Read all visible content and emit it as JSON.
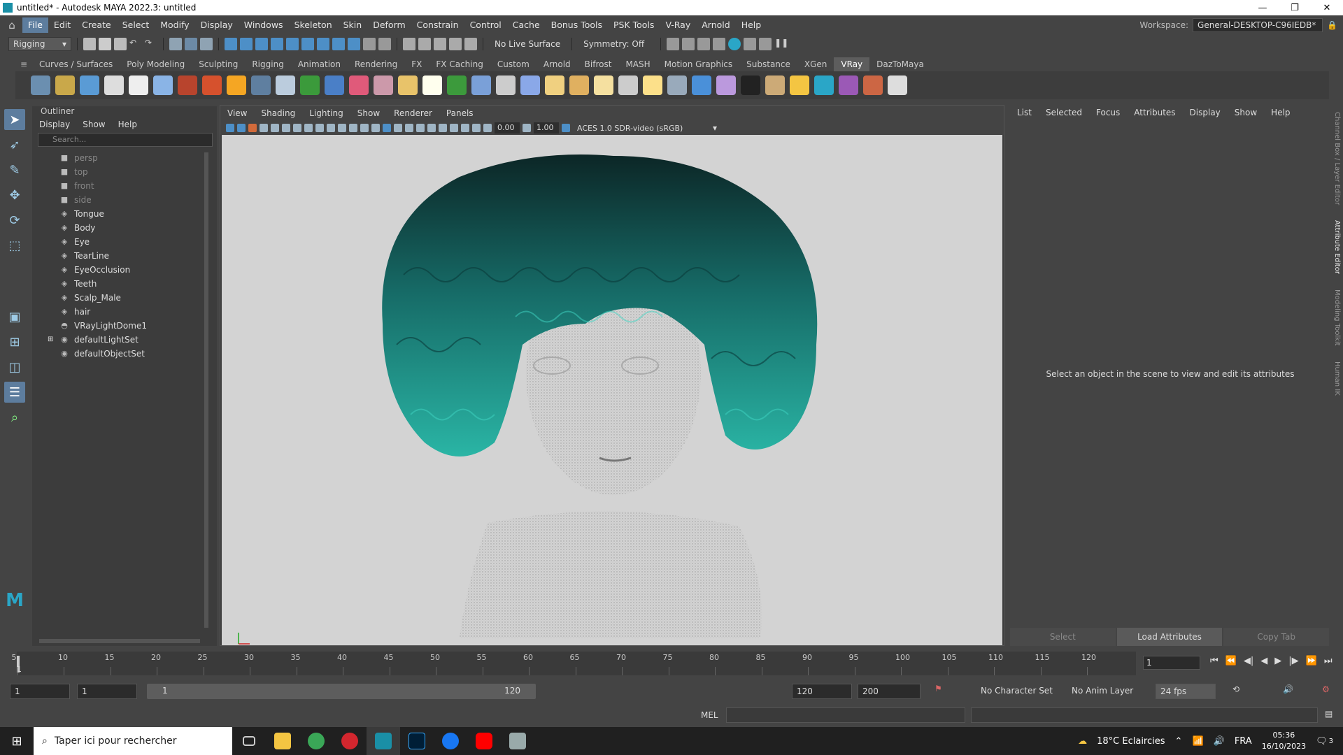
{
  "window": {
    "title": "untitled* - Autodesk MAYA 2022.3: untitled",
    "min": "—",
    "restore": "❐",
    "close": "✕"
  },
  "menu": {
    "items": [
      "File",
      "Edit",
      "Create",
      "Select",
      "Modify",
      "Display",
      "Windows",
      "Skeleton",
      "Skin",
      "Deform",
      "Constrain",
      "Control",
      "Cache",
      "Bonus Tools",
      "PSK Tools",
      "V-Ray",
      "Arnold",
      "Help"
    ],
    "workspace_label": "Workspace:",
    "workspace_value": "General-DESKTOP-C96IEDB*"
  },
  "status": {
    "menuset": "Rigging",
    "live_surface": "No Live Surface",
    "symmetry": "Symmetry: Off"
  },
  "shelf_tabs": [
    "Curves / Surfaces",
    "Poly Modeling",
    "Sculpting",
    "Rigging",
    "Animation",
    "Rendering",
    "FX",
    "FX Caching",
    "Custom",
    "Arnold",
    "Bifrost",
    "MASH",
    "Motion Graphics",
    "Substance",
    "XGen",
    "VRay",
    "DazToMaya"
  ],
  "shelf_active": "VRay",
  "outliner": {
    "title": "Outliner",
    "menu": [
      "Display",
      "Show",
      "Help"
    ],
    "search_placeholder": "Search...",
    "items": [
      {
        "label": "persp",
        "icon": "camera-icon",
        "dim": true
      },
      {
        "label": "top",
        "icon": "camera-icon",
        "dim": true
      },
      {
        "label": "front",
        "icon": "camera-icon",
        "dim": true
      },
      {
        "label": "side",
        "icon": "camera-icon",
        "dim": true
      },
      {
        "label": "Tongue",
        "icon": "mesh-icon",
        "dim": false
      },
      {
        "label": "Body",
        "icon": "mesh-icon",
        "dim": false
      },
      {
        "label": "Eye",
        "icon": "mesh-icon",
        "dim": false
      },
      {
        "label": "TearLine",
        "icon": "mesh-icon",
        "dim": false
      },
      {
        "label": "EyeOcclusion",
        "icon": "mesh-icon",
        "dim": false
      },
      {
        "label": "Teeth",
        "icon": "mesh-icon",
        "dim": false
      },
      {
        "label": "Scalp_Male",
        "icon": "mesh-icon",
        "dim": false
      },
      {
        "label": "hair",
        "icon": "mesh-icon",
        "dim": false
      },
      {
        "label": "VRayLightDome1",
        "icon": "dome-light-icon",
        "dim": false
      },
      {
        "label": "defaultLightSet",
        "icon": "set-icon",
        "dim": false
      },
      {
        "label": "defaultObjectSet",
        "icon": "set-icon",
        "dim": false
      }
    ]
  },
  "viewport": {
    "menu": [
      "View",
      "Shading",
      "Lighting",
      "Show",
      "Renderer",
      "Panels"
    ],
    "exposure": "0.00",
    "gamma": "1.00",
    "color_space": "ACES 1.0 SDR-video (sRGB)"
  },
  "attribute_editor": {
    "menu": [
      "List",
      "Selected",
      "Focus",
      "Attributes",
      "Display",
      "Show",
      "Help"
    ],
    "message": "Select an object in the scene to view and edit its attributes",
    "buttons": [
      "Select",
      "Load Attributes",
      "Copy Tab"
    ]
  },
  "side_tabs": [
    "Channel Box / Layer Editor",
    "Attribute Editor",
    "Modeling Toolkit",
    "Human IK"
  ],
  "timeline": {
    "ticks": [
      "5",
      "10",
      "15",
      "20",
      "25",
      "30",
      "35",
      "40",
      "45",
      "50",
      "55",
      "60",
      "65",
      "70",
      "75",
      "80",
      "85",
      "90",
      "95",
      "100",
      "105",
      "110",
      "115",
      "120"
    ],
    "current": "1",
    "start_marker": "1"
  },
  "range": {
    "start": "1",
    "anim_start": "1",
    "slider_start": "1",
    "slider_end": "120",
    "end": "120",
    "anim_end": "200",
    "character_set": "No Character Set",
    "anim_layer": "No Anim Layer",
    "fps": "24 fps"
  },
  "cmdline": {
    "lang": "MEL"
  },
  "taskbar": {
    "search_placeholder": "Taper ici pour rechercher",
    "weather": "18°C Eclaircies",
    "lang": "FRA",
    "time": "05:36",
    "date": "16/10/2023",
    "notif": "3"
  },
  "colors": {
    "hair_top": "#0c2626",
    "hair_bottom": "#2ab5a5",
    "bg": "#d3d3d3"
  }
}
